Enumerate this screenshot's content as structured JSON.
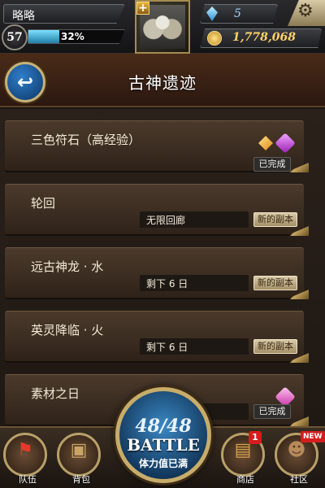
{
  "player": {
    "name": "略略",
    "level": "57",
    "exp_percent_label": "32%",
    "exp_fraction": 0.32
  },
  "currency": {
    "gems": "5",
    "coins": "1,778,068"
  },
  "header": {
    "title": "古神遗迹"
  },
  "quests": [
    {
      "title": "三色符石（高经验）",
      "info": "",
      "tag": "已完成",
      "icons": [
        "orange-gem-icon",
        "purple-gem-icon"
      ]
    },
    {
      "title": "轮回",
      "info": "无限回廊",
      "tag": "新的副本",
      "icons": []
    },
    {
      "title": "远古神龙 · 水",
      "info": "剩下 6 日",
      "tag": "新的副本",
      "icons": []
    },
    {
      "title": "英灵降临 · 火",
      "info": "剩下 6 日",
      "tag": "新的副本",
      "icons": []
    },
    {
      "title": "素材之日",
      "info": "",
      "tag": "已完成",
      "icons": [
        "pink-gem-icon"
      ]
    }
  ],
  "battle": {
    "stamina_current": "48",
    "stamina_max": "48",
    "label": "BATTLE",
    "status": "体力值已满"
  },
  "nav": {
    "team": "队伍",
    "bag": "背包",
    "shop": "商店",
    "shop_badge": "1",
    "community": "社区",
    "community_badge": "NEW"
  },
  "colors": {
    "accent_gold": "#c7ac6a",
    "exp_blue": "#7fe1ff",
    "badge_red": "#d61d1d"
  }
}
